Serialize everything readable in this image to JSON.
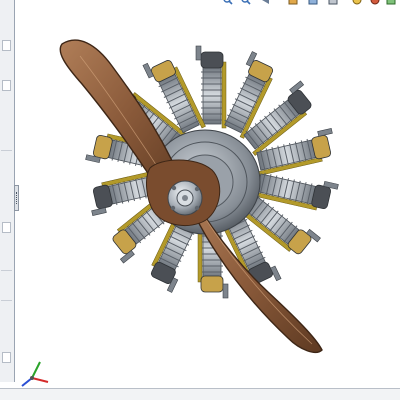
{
  "window": {
    "status_text": ""
  },
  "view_toolbar": {
    "icons": [
      "zoom-to-fit-icon",
      "zoom-to-area-icon",
      "previous-view-icon",
      "section-view-icon",
      "view-orientation-icon",
      "display-style-icon",
      "hide-show-icon",
      "edit-appearance-icon",
      "apply-scene-icon",
      "view-settings-icon"
    ]
  },
  "model": {
    "name": "radial-engine-assembly",
    "colors": {
      "propeller": "#8a5a3a",
      "propeller_edge": "#3d2616",
      "crankcase": "#8c939c",
      "cylinder_fin": "#9aa1a9",
      "pushrod": "#b39a2a",
      "rocker_cover": "#c7a24a",
      "hub": "#c6ccd2",
      "background": "#ffffff"
    }
  },
  "triad": {
    "x_label": "",
    "y_label": "",
    "z_label": ""
  }
}
